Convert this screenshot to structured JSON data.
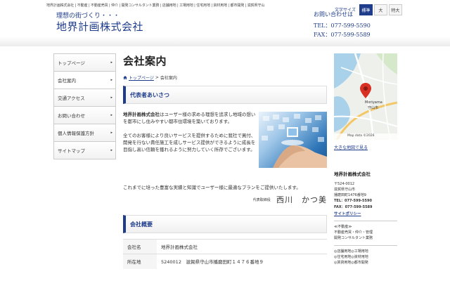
{
  "header": {
    "top_strip": "地界計画株式会社 | 不動産 | 不動産売買 | 仲介 | 開発コンサルタント業務 | 店舗用地 | 工場用地 | 住宅用地 | 資材用地 | 都市開発 | 滋賀県守山",
    "tagline": "理想の街づくり・・・",
    "company_logo": "地界計画株式会社",
    "font_size_label": "文字サイズ",
    "font_size_buttons": [
      "標準",
      "大",
      "特大"
    ],
    "contact_title": "お問い合わせは",
    "tel": "TEL：077-599-5590",
    "fax": "FAX：077-599-5589"
  },
  "nav": {
    "items": [
      {
        "label": "トップページ"
      },
      {
        "label": "会社案内"
      },
      {
        "label": "交通アクセス"
      },
      {
        "label": "お問い合わせ"
      },
      {
        "label": "個人情報保護方針"
      },
      {
        "label": "サイトマップ"
      }
    ],
    "arrow": "▸"
  },
  "main": {
    "title": "会社案内",
    "breadcrumb_home": "トップページ",
    "breadcrumb_sep": ">",
    "breadcrumb_current": "会社案内",
    "greeting_heading": "代表者あいさつ",
    "greeting_p1_bold": "地界計画株式会社",
    "greeting_p1_rest": "はユーザー様の求める理想を追求し地域の想いを都市にし住みやすい都市住環境を築いております。",
    "greeting_p2": "全てのお客様により良いサービスを提供するために我社で買付、開発を行ない責任施工を成しサービス提供ができるように成長を目指し高い信頼を獲れるように努力していく所存でございます。",
    "greeting_p3": "これまでに培った豊富な実績と知識でユーザー様に最適なプランをご提供いたします。",
    "sign_role": "代表取締役",
    "sign_name": "西川　かつ美",
    "overview_heading": "会社概要",
    "overview_rows": [
      {
        "key": "会社名",
        "value": "地界計画株式会社"
      },
      {
        "key": "所在地",
        "value": "5240012　滋賀県守山市播磨田町１４７６番地９"
      }
    ]
  },
  "side": {
    "map_label_en": "Moriyama",
    "map_label_jp": "守山市",
    "map_footer": "Map data ©2026",
    "map_link": "大きな地図で見る",
    "company": "地界計画株式会社",
    "postal": "〒524-0012",
    "addr1": "滋賀県守山市",
    "addr2": "播磨田町1476番地9",
    "tel": "TEL：077-599-5590",
    "fax": "FAX：077-599-5589",
    "policy": "サイトポリシー",
    "biz_title": "≪不動産≫",
    "biz_line1": "不動産売買・仲介・管理",
    "biz_line2": "開発コンサルタント業務",
    "use_line1": "◎店舗用地◎工場用地",
    "use_line2": "◎住宅用地◎資材用地",
    "use_line3": "◎賃貸用地◎都市開発"
  },
  "colors": {
    "brand": "#1e3c8c",
    "map_pin": "#d93025"
  }
}
